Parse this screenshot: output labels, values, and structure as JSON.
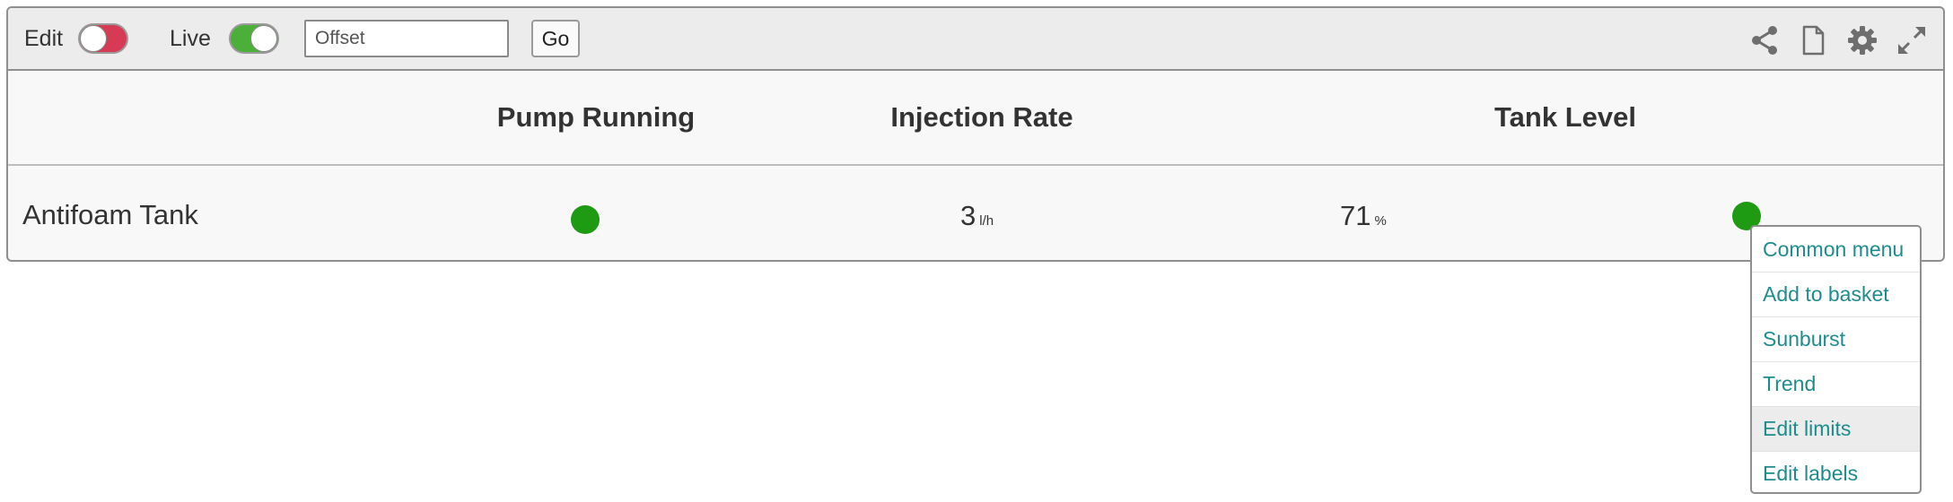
{
  "toolbar": {
    "edit_label": "Edit",
    "edit_toggle_state": "off",
    "live_label": "Live",
    "live_toggle_state": "on",
    "offset_placeholder": "Offset",
    "go_label": "Go",
    "icons": [
      "share-icon",
      "file-icon",
      "gear-icon",
      "expand-icon"
    ]
  },
  "table": {
    "columns": [
      "Pump Running",
      "Injection Rate",
      "Tank Level"
    ],
    "rows": [
      {
        "label": "Antifoam Tank",
        "pump_running": "on",
        "injection_rate": {
          "value": "3",
          "unit": "l/h"
        },
        "tank_level": {
          "value": "71",
          "unit": "%"
        },
        "extra_status": "on"
      }
    ]
  },
  "context_menu": {
    "items": [
      "Common menu",
      "Add to basket",
      "Sunburst",
      "Trend",
      "Edit limits",
      "Edit labels"
    ],
    "highlighted": "Edit limits"
  },
  "colors": {
    "status_green": "#1e9a13",
    "toggle_off": "#d63a55",
    "toggle_on": "#4caf3a",
    "menu_text": "#1f8c8c"
  }
}
